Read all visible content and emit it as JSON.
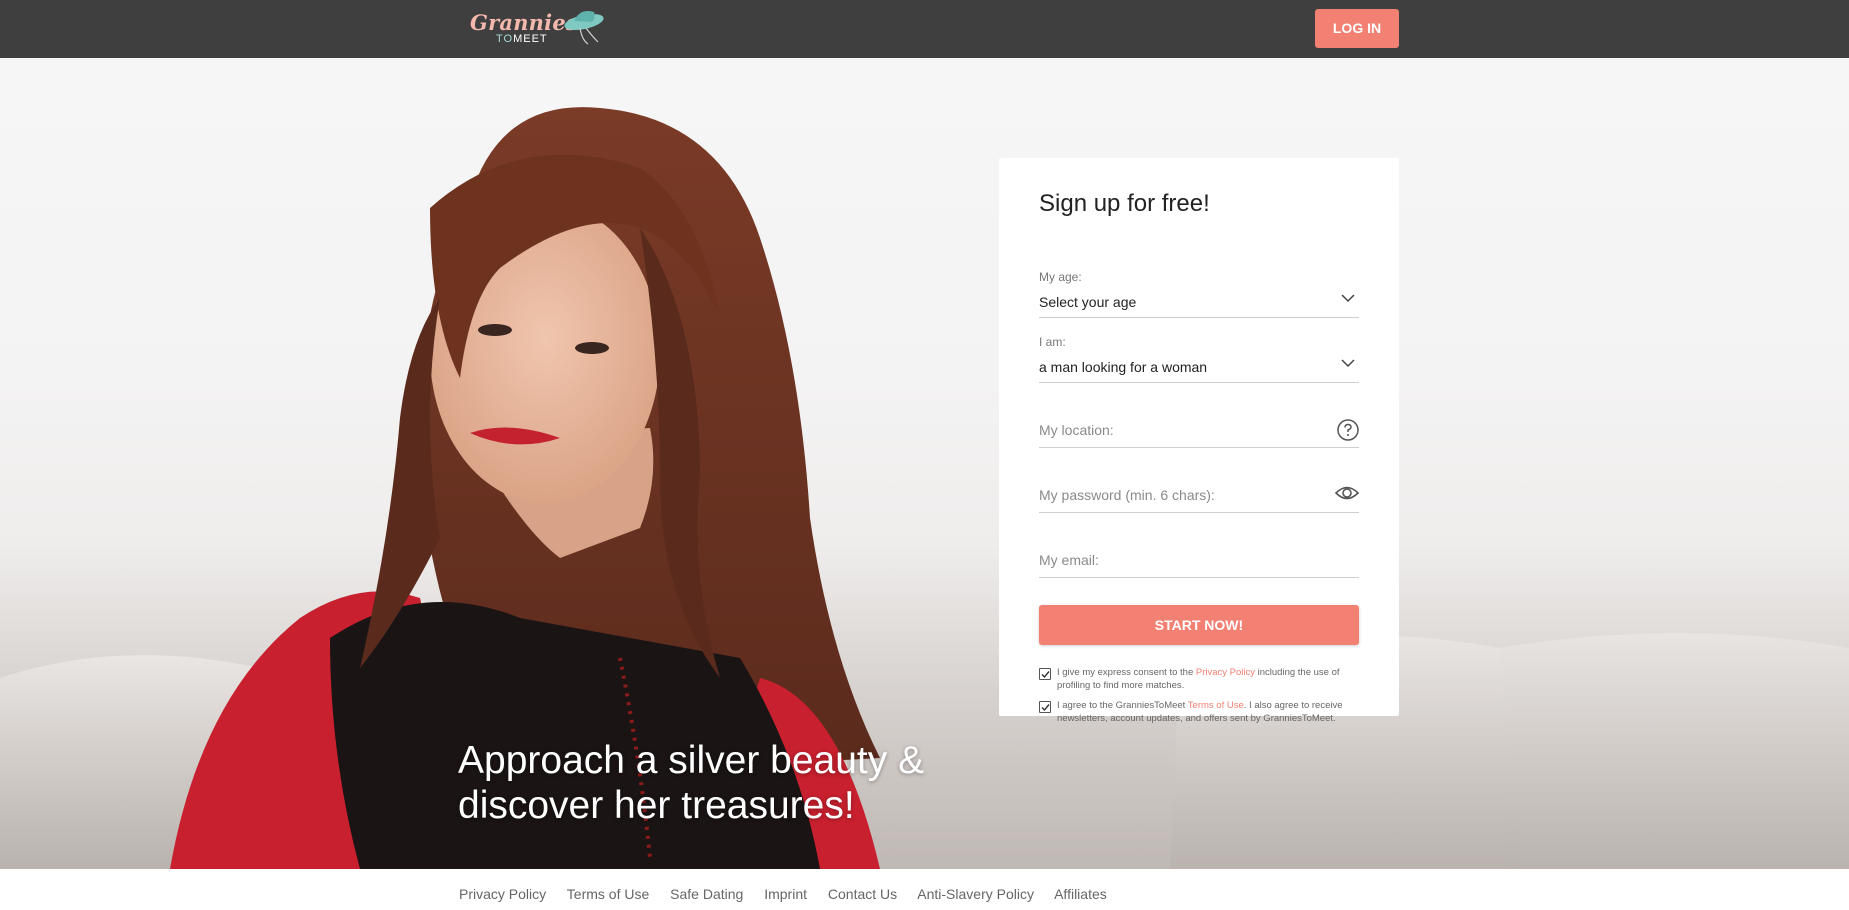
{
  "header": {
    "logo_line1": "Grannies",
    "logo_to": "TO",
    "logo_meet": "MEET",
    "login_label": "LOG IN"
  },
  "hero": {
    "tagline_line1": "Approach a silver beauty &",
    "tagline_line2": "discover her treasures!"
  },
  "signup": {
    "title": "Sign up for free!",
    "age_label": "My age:",
    "age_value": "Select your age",
    "iam_label": "I am:",
    "iam_value": "a man looking for a woman",
    "location_placeholder": "My location:",
    "password_placeholder": "My password (min. 6 chars):",
    "email_placeholder": "My email:",
    "start_label": "START NOW!",
    "consent1_pre": "I give my express consent to the ",
    "consent1_link": "Privacy Policy",
    "consent1_post": " including the use of profiling to find more matches.",
    "consent2_pre": "I agree to the GranniesToMeet ",
    "consent2_link": "Terms of Use",
    "consent2_post": ". I also agree to receive newsletters, account updates, and offers sent by GranniesToMeet.",
    "icons": {
      "dropdown": "chevron-down-icon",
      "help": "question-circle-icon",
      "show_password": "eye-icon",
      "checkbox": "checkmark-icon"
    },
    "accent_color": "#f28073"
  },
  "footer": {
    "links": [
      "Privacy Policy",
      "Terms of Use",
      "Safe Dating",
      "Imprint",
      "Contact Us",
      "Anti-Slavery Policy",
      "Affiliates"
    ]
  }
}
